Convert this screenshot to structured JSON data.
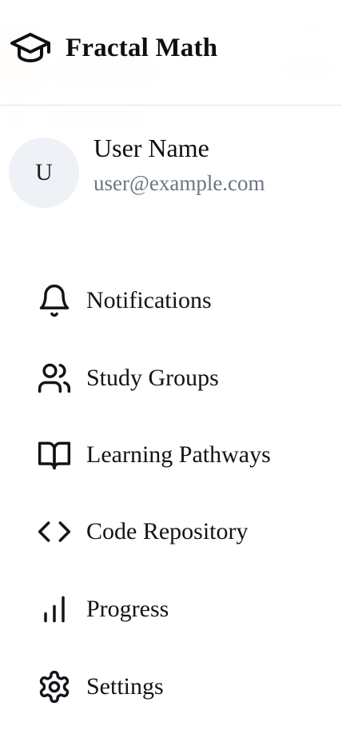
{
  "app": {
    "title": "Fractal Math",
    "logo_icon": "graduation-cap-icon"
  },
  "profile": {
    "avatar_initial": "U",
    "name": "User Name",
    "email": "user@example.com"
  },
  "menu": {
    "items": [
      {
        "label": "Notifications",
        "icon": "bell-icon"
      },
      {
        "label": "Study Groups",
        "icon": "users-icon"
      },
      {
        "label": "Learning Pathways",
        "icon": "book-open-icon"
      },
      {
        "label": "Code Repository",
        "icon": "code-icon"
      },
      {
        "label": "Progress",
        "icon": "bar-chart-icon"
      },
      {
        "label": "Settings",
        "icon": "gear-icon"
      }
    ]
  },
  "colors": {
    "text": "#111418",
    "muted_text": "#6b7585",
    "avatar_bg": "#eef1f6",
    "divider": "#e2e4e8"
  }
}
